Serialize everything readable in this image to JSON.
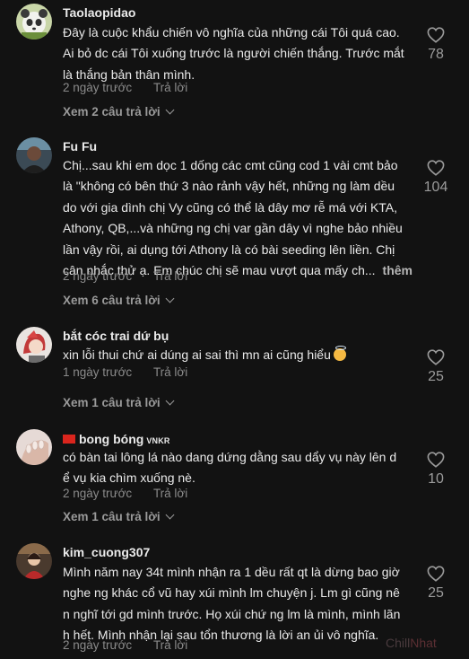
{
  "comments": [
    {
      "username": "Taolaopidao",
      "lines": [
        "Đây là cuộc khẩu chiến vô nghĩa của những cái Tôi quá cao.",
        "Ai bỏ dc cái Tôi xuống trước là người chiến thắng. Trước mắt",
        "là thắng bản thân mình."
      ],
      "time": "2 ngày trước",
      "reply": "Trả lời",
      "view_replies": "Xem 2 câu trả lời",
      "likes": "78"
    },
    {
      "username": "Fu Fu",
      "lines": [
        "Chị...sau khi em dọc 1 dống các cmt cũng cod 1 vài cmt bảo",
        "là \"không có bên thứ 3 nào rảnh vậy hết, những ng làm dều",
        "do với gia dình chị Vy cũng có thể là dây mơ rễ má với KTA,",
        "Athony, QB,...và những ng chị var gần dây vì nghe bảo nhiều",
        "lần vậy rồi, ai dụng tới Athony là có bài seeding lên liền. Chị",
        "cân nhắc thử ạ. Em chúc chị sẽ mau vượt qua mấy ch..."
      ],
      "more": "thêm",
      "time": "2 ngày trước",
      "reply": "Trả lời",
      "view_replies": "Xem 6 câu trả lời",
      "likes": "104"
    },
    {
      "username": "bắt cóc trai dứ bụ",
      "lines": [
        "xin lỗi thui chứ ai dúng ai sai thì mn ai cũng hiểu"
      ],
      "emoji": "innocent-emoji",
      "time": "1 ngày trước",
      "reply": "Trả lời",
      "view_replies": "Xem 1 câu trả lời",
      "likes": "25"
    },
    {
      "username": "bong bóng",
      "badge": "VNKR",
      "lines": [
        "có bàn tai lông lá nào dang dứng dằng sau dẩy vụ này lên d",
        "ể vụ kia chìm xuống nè."
      ],
      "time": "2 ngày trước",
      "reply": "Trả lời",
      "view_replies": "Xem 1 câu trả lời",
      "likes": "10"
    },
    {
      "username": "kim_cuong307",
      "lines": [
        "Mình năm nay 34t mình nhận ra 1 dều rất qt là dừng bao giờ",
        "nghe ng khác cổ vũ hay xúi mình lm chuyện j. Lm gì cũng nê",
        "n nghĩ tới gd mình trước. Họ xúi chứ ng lm là mình, mình lãn",
        "h hết. Mình nhận lại sau tổn thương là lời an ủi vô nghĩa."
      ],
      "time": "2 ngày trước",
      "reply": "Trả lời",
      "likes": "25"
    }
  ],
  "watermark": {
    "part1": "Chill",
    "part2": "Nhat"
  },
  "colors": {
    "background": "#121212",
    "text": "#e9e9e9",
    "muted": "#8a8a8a",
    "flag": "#da251d"
  }
}
